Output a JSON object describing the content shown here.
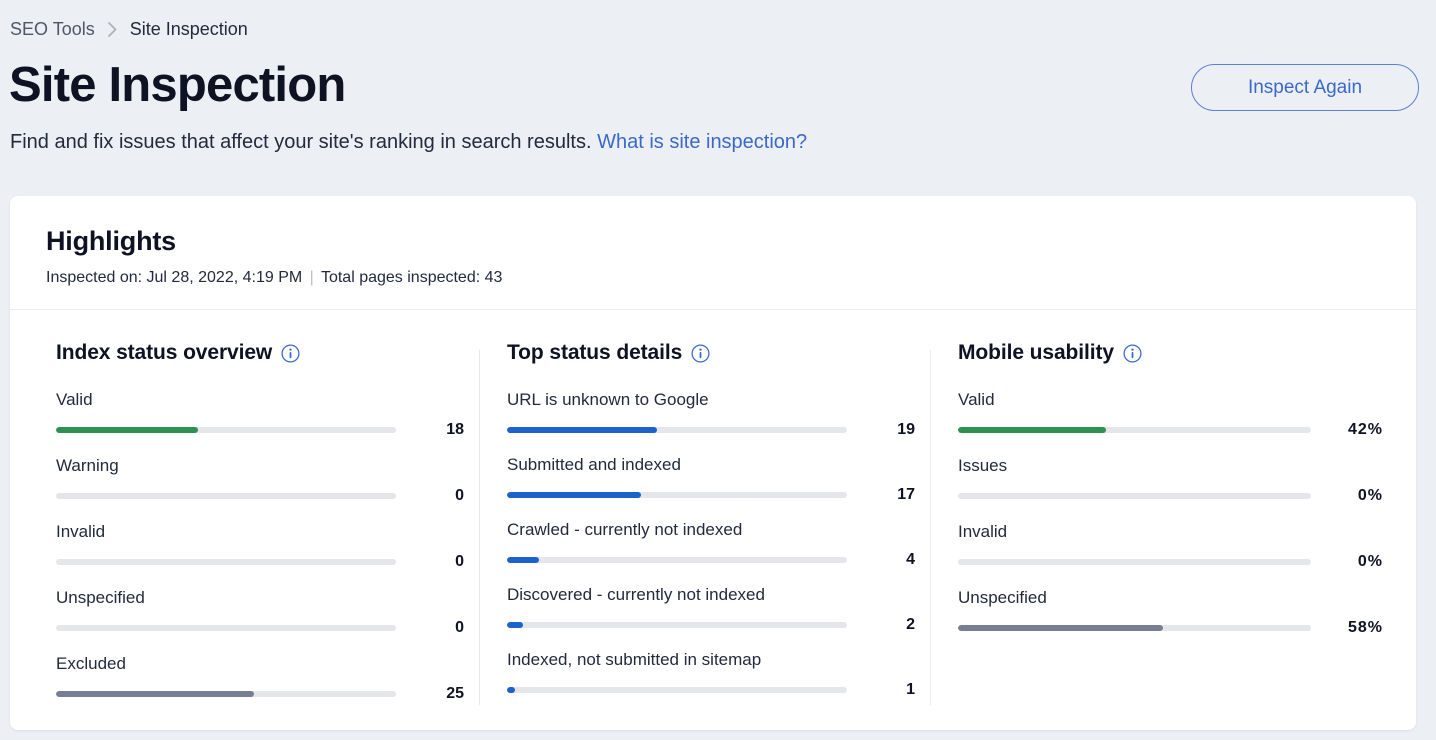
{
  "breadcrumb": {
    "root": "SEO Tools",
    "separator_icon": "chevron-right-icon",
    "current": "Site Inspection"
  },
  "header": {
    "title": "Site Inspection",
    "subtitle_text": "Find and fix issues that affect your site's ranking in search results.",
    "subtitle_link": "What is site inspection?",
    "inspect_again_label": "Inspect Again"
  },
  "colors": {
    "page_background": "#eceff3",
    "card_background": "#ffffff",
    "accent_link": "#3a69cc",
    "valid_green": "#2e9153",
    "blue_bar": "#1b62cd",
    "unspecified_gray": "#777e94",
    "track_gray": "#e4e6ea",
    "title_dark": "#0e1223"
  },
  "highlights": {
    "title": "Highlights",
    "inspected_on_label": "Inspected on:",
    "inspected_on_value": "Jul 28, 2022, 4:19 PM",
    "separator": "|",
    "total_pages_label": "Total pages inspected:",
    "total_pages_value": "43"
  },
  "chart_data": [
    {
      "type": "bar",
      "title": "Index status overview",
      "info_icon": "info-icon",
      "orientation": "horizontal",
      "categories": [
        "Valid",
        "Warning",
        "Invalid",
        "Unspecified",
        "Excluded"
      ],
      "values": [
        18,
        0,
        0,
        0,
        25
      ],
      "value_labels": [
        "18",
        "0",
        "0",
        "0",
        "25"
      ],
      "percents": [
        41.9,
        0,
        0,
        0,
        58.1
      ],
      "colors": [
        "#2e9153",
        "#e4e6ea",
        "#e4e6ea",
        "#e4e6ea",
        "#777e94"
      ],
      "max": 43,
      "grid": false,
      "legend": "none"
    },
    {
      "type": "bar",
      "title": "Top status details",
      "info_icon": "info-icon",
      "orientation": "horizontal",
      "categories": [
        "URL is unknown to Google",
        "Submitted and indexed",
        "Crawled - currently not indexed",
        "Discovered - currently not indexed",
        "Indexed, not submitted in sitemap"
      ],
      "values": [
        19,
        17,
        4,
        2,
        1
      ],
      "value_labels": [
        "19",
        "17",
        "4",
        "2",
        "1"
      ],
      "percents": [
        44.2,
        39.5,
        9.3,
        4.7,
        2.3
      ],
      "colors": [
        "#1b62cd",
        "#1b62cd",
        "#1b62cd",
        "#1b62cd",
        "#1b62cd"
      ],
      "max": 43,
      "grid": false,
      "legend": "none"
    },
    {
      "type": "bar",
      "title": "Mobile usability",
      "info_icon": "info-icon",
      "orientation": "horizontal",
      "categories": [
        "Valid",
        "Issues",
        "Invalid",
        "Unspecified"
      ],
      "values": [
        42,
        0,
        0,
        58
      ],
      "value_labels": [
        "42%",
        "0%",
        "0%",
        "58%"
      ],
      "percents": [
        42,
        0,
        0,
        58
      ],
      "colors": [
        "#2e9153",
        "#e4e6ea",
        "#e4e6ea",
        "#777e94"
      ],
      "max": 100,
      "grid": false,
      "legend": "none"
    }
  ]
}
